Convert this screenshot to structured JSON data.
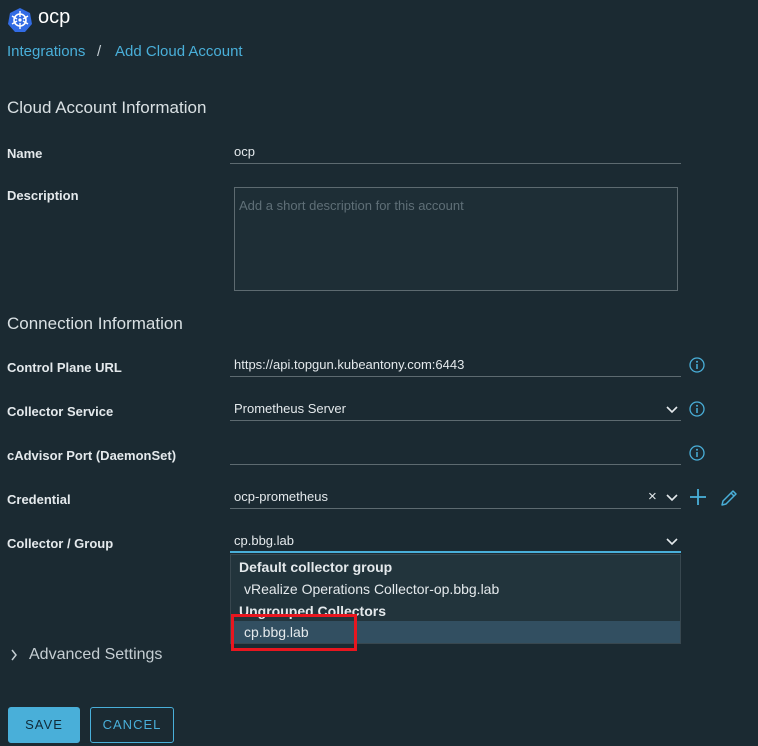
{
  "header": {
    "title": "ocp",
    "breadcrumb": {
      "parent": "Integrations",
      "separator": "/",
      "current": "Add Cloud Account"
    }
  },
  "sections": {
    "cloud_account": "Cloud Account Information",
    "connection": "Connection Information"
  },
  "form": {
    "name": {
      "label": "Name",
      "value": "ocp"
    },
    "description": {
      "label": "Description",
      "placeholder": "Add a short description for this account"
    },
    "control_plane_url": {
      "label": "Control Plane URL",
      "value": "https://api.topgun.kubeantony.com:6443"
    },
    "collector_service": {
      "label": "Collector Service",
      "value": "Prometheus Server"
    },
    "cadvisor_port": {
      "label": "cAdvisor Port (DaemonSet)",
      "value": ""
    },
    "credential": {
      "label": "Credential",
      "value": "ocp-prometheus",
      "clear": "×"
    },
    "collector_group": {
      "label": "Collector / Group",
      "value": "cp.bbg.lab"
    }
  },
  "dropdown": {
    "groups": [
      {
        "header": "Default collector group",
        "items": [
          "vRealize Operations Collector-op.bbg.lab"
        ]
      },
      {
        "header": "Ungrouped Collectors",
        "items": [
          "cp.bbg.lab"
        ]
      }
    ],
    "selected": "cp.bbg.lab"
  },
  "advanced": {
    "label": "Advanced Settings"
  },
  "buttons": {
    "save": "SAVE",
    "cancel": "CANCEL"
  },
  "icons": {
    "logo": "kubernetes-icon",
    "info": "info-icon",
    "chevron": "chevron-down-icon",
    "add": "plus-icon",
    "edit": "pencil-icon"
  },
  "colors": {
    "background": "#1b2a32",
    "accent": "#49afd9",
    "selected_row": "#324f61",
    "highlight_box": "#e8161f",
    "kubernetes_blue": "#326ce5"
  }
}
